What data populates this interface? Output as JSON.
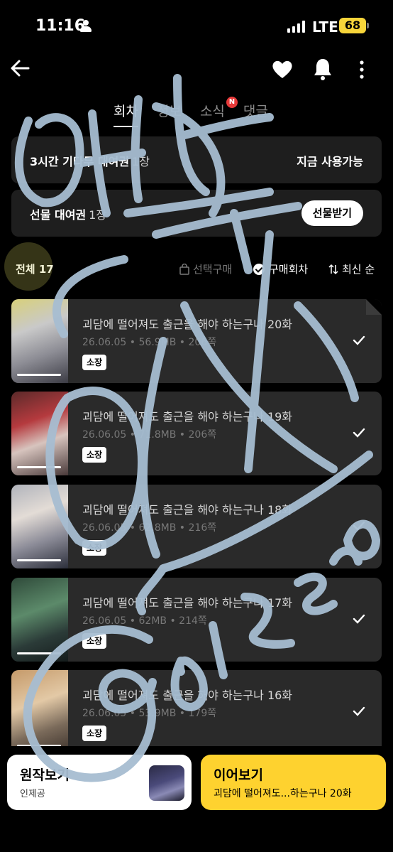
{
  "status_bar": {
    "time": "11:16",
    "network": "LTE",
    "battery": "68"
  },
  "header": {
    "icons": [
      "back-arrow-icon",
      "heart-icon",
      "bell-icon",
      "more-vertical-icon"
    ]
  },
  "tabs": [
    {
      "label": "회차",
      "active": true
    },
    {
      "label": "정보",
      "active": false
    },
    {
      "label": "소식",
      "active": false,
      "badge": "N"
    },
    {
      "label": "댓글",
      "active": false
    }
  ],
  "tickets": {
    "wait_label": "3시간 기다무 대여권",
    "wait_count": "1장",
    "wait_status": "지금 사용가능",
    "gift_label": "선물 대여권",
    "gift_count": "1장",
    "gift_button": "선물받기"
  },
  "filter": {
    "total": "전체 17",
    "select_buy": "선택구매",
    "bought": "구매회차",
    "sort": "최신 순"
  },
  "episodes": [
    {
      "title": "괴담에 떨어져도 출근을 해야 하는구나 20화",
      "meta": "26.06.05 • 56.9MB • 206쪽",
      "badge": "소장",
      "progress": 1.0
    },
    {
      "title": "괴담에 떨어져도 출근을 해야 하는구나 19화",
      "meta": "26.06.05 • 71.8MB • 206쪽",
      "badge": "소장",
      "progress": 1.0
    },
    {
      "title": "괴담에 떨어져도 출근을 해야 하는구나 18화",
      "meta": "26.06.05 • 62.8MB • 216쪽",
      "badge": "소장",
      "progress": 1.0
    },
    {
      "title": "괴담에 떨어져도 출근을 해야 하는구나 17화",
      "meta": "26.06.05 • 62MB • 214쪽",
      "badge": "소장",
      "progress": 1.0
    },
    {
      "title": "괴담에 떨어져도 출근을 해야 하는구나 16화",
      "meta": "26.06.05 • 53.9MB • 179쪽",
      "badge": "소장",
      "progress": 1.0
    }
  ],
  "bottom": {
    "original_title": "원작보기",
    "original_sub": "인제공",
    "continue_title": "이어보기",
    "continue_sub": "괴담에 떨어져도...하는구나 20화"
  },
  "overlay_handwriting": [
    "맛보소",
    "ON",
    "@01zero"
  ],
  "colors": {
    "accent": "#fed22f",
    "background": "#000000",
    "card": "#2a2a2a",
    "scribble": "#a6bdd1"
  }
}
